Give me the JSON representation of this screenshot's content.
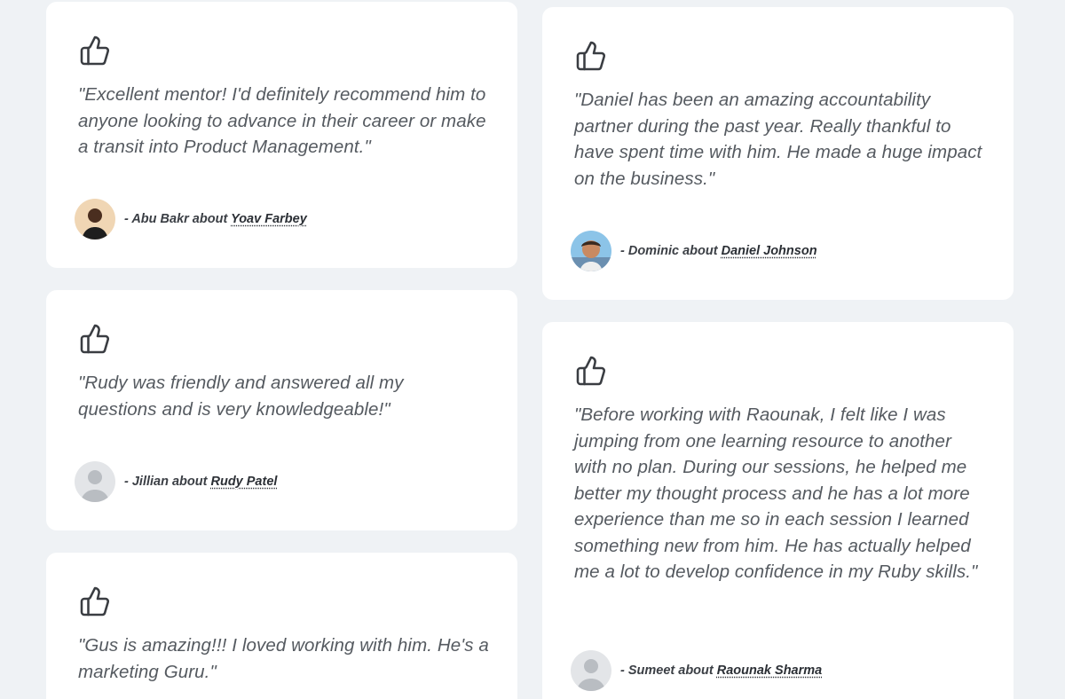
{
  "testimonials": [
    {
      "icon": "thumbs-up-icon",
      "quote": "\"Excellent mentor! I'd definitely recommend him to anyone looking to advance in their career or make a transit into Product Management.\"",
      "reviewer_prefix": "- Abu Bakr about",
      "mentor": "Yoav Farbey",
      "avatar": "reviewer-photo"
    },
    {
      "icon": "thumbs-up-icon",
      "quote": "\"Rudy was friendly and answered all my questions and is very knowledgeable!\"",
      "reviewer_prefix": "- Jillian about",
      "mentor": "Rudy Patel",
      "avatar": "default-avatar"
    },
    {
      "icon": "thumbs-up-icon",
      "quote": "\"Gus is amazing!!! I loved working with him. He's a marketing Guru.\""
    },
    {
      "icon": "thumbs-up-icon",
      "quote": "\"Daniel has been an amazing accountability partner during the past year. Really thankful to have spent time with him. He made a huge impact on the business.\"",
      "reviewer_prefix": "- Dominic about",
      "mentor": "Daniel Johnson",
      "avatar": "reviewer-photo"
    },
    {
      "icon": "thumbs-up-icon",
      "quote": "\"Before working with Raounak, I felt like I was jumping from one learning resource to another with no plan. During our sessions, he helped me better my thought process and he has a lot more experience than me so in each session I learned something new from him. He has actually helped me a lot to develop confidence in my Ruby skills.\"",
      "reviewer_prefix": "- Sumeet about",
      "mentor": "Raounak Sharma",
      "avatar": "default-avatar"
    }
  ],
  "colors": {
    "page_background": "#eff2f5",
    "card_background": "#ffffff",
    "quote_text": "#555a60",
    "byline_text": "#3b3f45"
  }
}
